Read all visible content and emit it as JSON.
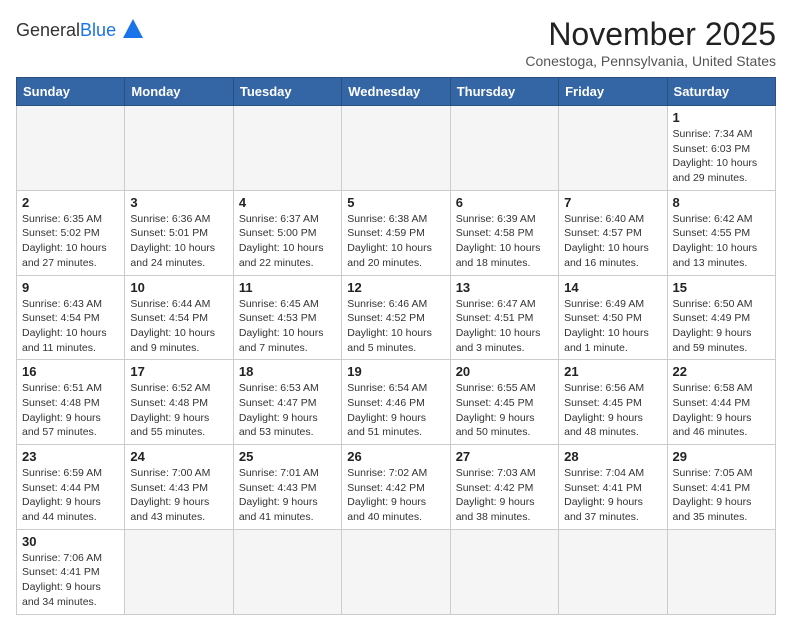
{
  "header": {
    "logo_general": "General",
    "logo_blue": "Blue",
    "month": "November 2025",
    "location": "Conestoga, Pennsylvania, United States"
  },
  "weekdays": [
    "Sunday",
    "Monday",
    "Tuesday",
    "Wednesday",
    "Thursday",
    "Friday",
    "Saturday"
  ],
  "weeks": [
    [
      {
        "day": "",
        "info": ""
      },
      {
        "day": "",
        "info": ""
      },
      {
        "day": "",
        "info": ""
      },
      {
        "day": "",
        "info": ""
      },
      {
        "day": "",
        "info": ""
      },
      {
        "day": "",
        "info": ""
      },
      {
        "day": "1",
        "info": "Sunrise: 7:34 AM\nSunset: 6:03 PM\nDaylight: 10 hours and 29 minutes."
      }
    ],
    [
      {
        "day": "2",
        "info": "Sunrise: 6:35 AM\nSunset: 5:02 PM\nDaylight: 10 hours and 27 minutes."
      },
      {
        "day": "3",
        "info": "Sunrise: 6:36 AM\nSunset: 5:01 PM\nDaylight: 10 hours and 24 minutes."
      },
      {
        "day": "4",
        "info": "Sunrise: 6:37 AM\nSunset: 5:00 PM\nDaylight: 10 hours and 22 minutes."
      },
      {
        "day": "5",
        "info": "Sunrise: 6:38 AM\nSunset: 4:59 PM\nDaylight: 10 hours and 20 minutes."
      },
      {
        "day": "6",
        "info": "Sunrise: 6:39 AM\nSunset: 4:58 PM\nDaylight: 10 hours and 18 minutes."
      },
      {
        "day": "7",
        "info": "Sunrise: 6:40 AM\nSunset: 4:57 PM\nDaylight: 10 hours and 16 minutes."
      },
      {
        "day": "8",
        "info": "Sunrise: 6:42 AM\nSunset: 4:55 PM\nDaylight: 10 hours and 13 minutes."
      }
    ],
    [
      {
        "day": "9",
        "info": "Sunrise: 6:43 AM\nSunset: 4:54 PM\nDaylight: 10 hours and 11 minutes."
      },
      {
        "day": "10",
        "info": "Sunrise: 6:44 AM\nSunset: 4:54 PM\nDaylight: 10 hours and 9 minutes."
      },
      {
        "day": "11",
        "info": "Sunrise: 6:45 AM\nSunset: 4:53 PM\nDaylight: 10 hours and 7 minutes."
      },
      {
        "day": "12",
        "info": "Sunrise: 6:46 AM\nSunset: 4:52 PM\nDaylight: 10 hours and 5 minutes."
      },
      {
        "day": "13",
        "info": "Sunrise: 6:47 AM\nSunset: 4:51 PM\nDaylight: 10 hours and 3 minutes."
      },
      {
        "day": "14",
        "info": "Sunrise: 6:49 AM\nSunset: 4:50 PM\nDaylight: 10 hours and 1 minute."
      },
      {
        "day": "15",
        "info": "Sunrise: 6:50 AM\nSunset: 4:49 PM\nDaylight: 9 hours and 59 minutes."
      }
    ],
    [
      {
        "day": "16",
        "info": "Sunrise: 6:51 AM\nSunset: 4:48 PM\nDaylight: 9 hours and 57 minutes."
      },
      {
        "day": "17",
        "info": "Sunrise: 6:52 AM\nSunset: 4:48 PM\nDaylight: 9 hours and 55 minutes."
      },
      {
        "day": "18",
        "info": "Sunrise: 6:53 AM\nSunset: 4:47 PM\nDaylight: 9 hours and 53 minutes."
      },
      {
        "day": "19",
        "info": "Sunrise: 6:54 AM\nSunset: 4:46 PM\nDaylight: 9 hours and 51 minutes."
      },
      {
        "day": "20",
        "info": "Sunrise: 6:55 AM\nSunset: 4:45 PM\nDaylight: 9 hours and 50 minutes."
      },
      {
        "day": "21",
        "info": "Sunrise: 6:56 AM\nSunset: 4:45 PM\nDaylight: 9 hours and 48 minutes."
      },
      {
        "day": "22",
        "info": "Sunrise: 6:58 AM\nSunset: 4:44 PM\nDaylight: 9 hours and 46 minutes."
      }
    ],
    [
      {
        "day": "23",
        "info": "Sunrise: 6:59 AM\nSunset: 4:44 PM\nDaylight: 9 hours and 44 minutes."
      },
      {
        "day": "24",
        "info": "Sunrise: 7:00 AM\nSunset: 4:43 PM\nDaylight: 9 hours and 43 minutes."
      },
      {
        "day": "25",
        "info": "Sunrise: 7:01 AM\nSunset: 4:43 PM\nDaylight: 9 hours and 41 minutes."
      },
      {
        "day": "26",
        "info": "Sunrise: 7:02 AM\nSunset: 4:42 PM\nDaylight: 9 hours and 40 minutes."
      },
      {
        "day": "27",
        "info": "Sunrise: 7:03 AM\nSunset: 4:42 PM\nDaylight: 9 hours and 38 minutes."
      },
      {
        "day": "28",
        "info": "Sunrise: 7:04 AM\nSunset: 4:41 PM\nDaylight: 9 hours and 37 minutes."
      },
      {
        "day": "29",
        "info": "Sunrise: 7:05 AM\nSunset: 4:41 PM\nDaylight: 9 hours and 35 minutes."
      }
    ],
    [
      {
        "day": "30",
        "info": "Sunrise: 7:06 AM\nSunset: 4:41 PM\nDaylight: 9 hours and 34 minutes."
      },
      {
        "day": "",
        "info": ""
      },
      {
        "day": "",
        "info": ""
      },
      {
        "day": "",
        "info": ""
      },
      {
        "day": "",
        "info": ""
      },
      {
        "day": "",
        "info": ""
      },
      {
        "day": "",
        "info": ""
      }
    ]
  ]
}
